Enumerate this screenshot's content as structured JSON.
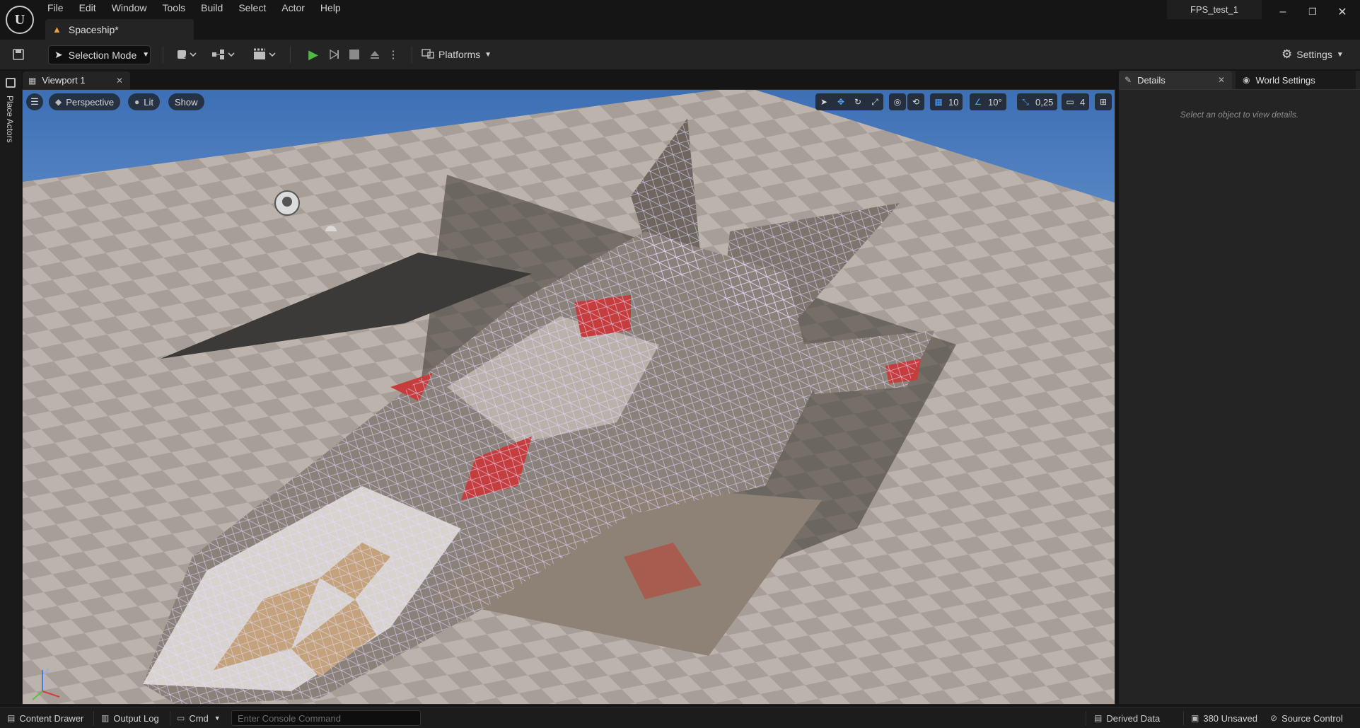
{
  "menu": [
    "File",
    "Edit",
    "Window",
    "Tools",
    "Build",
    "Select",
    "Actor",
    "Help"
  ],
  "document_tab": {
    "label": "Spaceship*"
  },
  "project_name": "FPS_test_1",
  "window_controls": {
    "minimize": "–",
    "restore": "❐",
    "close": "✕"
  },
  "toolbar": {
    "selection_mode": "Selection Mode",
    "platforms": "Platforms",
    "settings": "Settings"
  },
  "left_strip": {
    "place_actors": "Place Actors"
  },
  "viewport": {
    "tab_label": "Viewport 1",
    "view_mode": "Perspective",
    "lighting": "Lit",
    "show": "Show",
    "grid_snap": "10",
    "rotation_snap": "10°",
    "scale_snap": "0,25",
    "camera_speed": "4"
  },
  "details": {
    "tab_label": "Details",
    "world_settings_label": "World Settings",
    "empty_message": "Select an object to view details."
  },
  "statusbar": {
    "content_drawer": "Content Drawer",
    "output_log": "Output Log",
    "cmd": "Cmd",
    "console_placeholder": "Enter Console Command",
    "derived_data": "Derived Data",
    "unsaved": "380 Unsaved",
    "source_control": "Source Control"
  },
  "colors": {
    "accent_blue": "#4aa3ff",
    "play_green": "#4dbb3d",
    "warning_orange": "#e8a23a",
    "sky_blue": "#4a78b8"
  }
}
